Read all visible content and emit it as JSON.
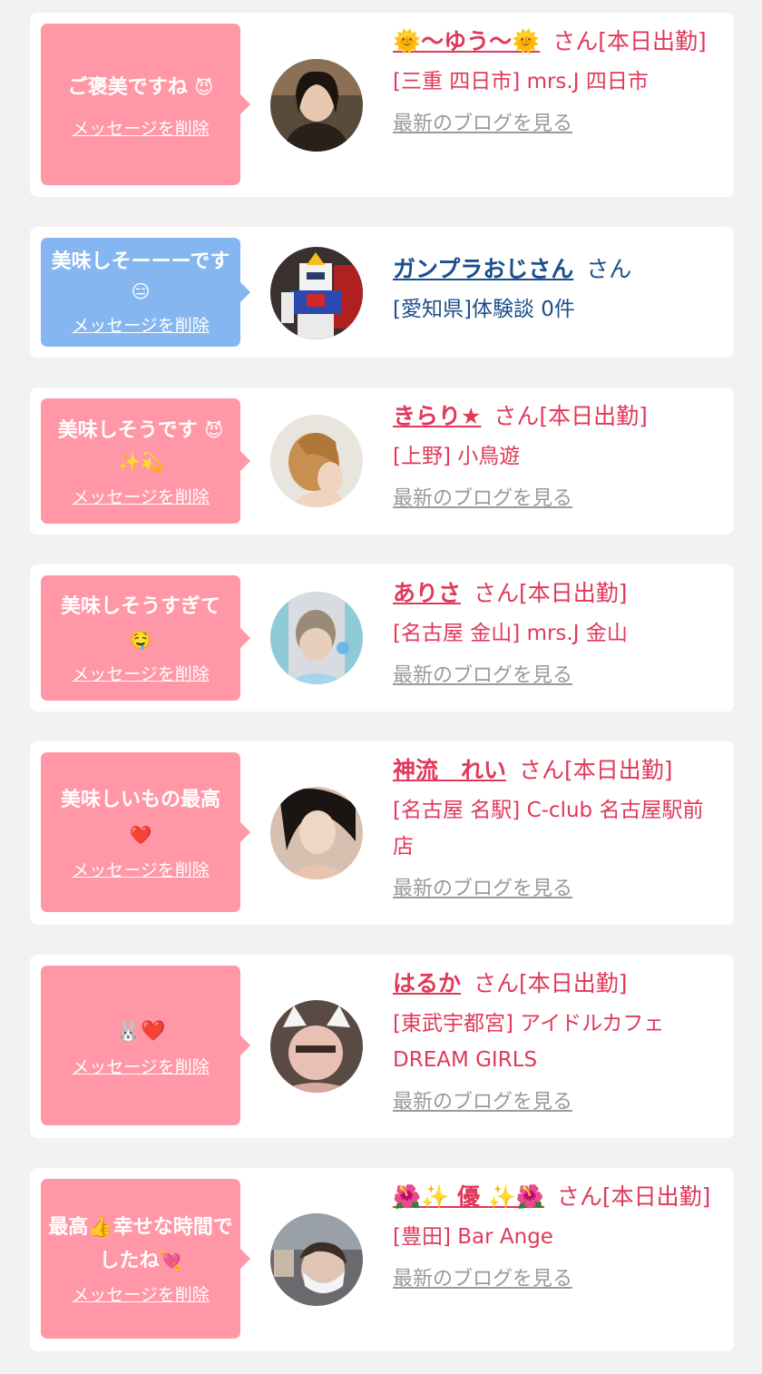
{
  "delete_label": "メッセージを削除",
  "blog_label": "最新のブログを見る",
  "cards": [
    {
      "message": "ご褒美ですね",
      "message_emoji": "😈",
      "name": "🌞〜ゆう〜🌞",
      "suffix": "さん[本日出勤]",
      "shop": "[三重 四日市] mrs.J 四日市",
      "blog": true,
      "bubble_color": "#ff97a6",
      "avatar_icon": "woman-portrait-photo"
    },
    {
      "message": "美味しそーーーです",
      "message_emoji": "😑",
      "name": "ガンプラおじさん",
      "suffix": "さん",
      "shop": "[愛知県]体験談 0件",
      "blog": false,
      "bubble_color": "#86b6ef",
      "avatar_icon": "gundam-model-photo"
    },
    {
      "message": "美味しそうです",
      "message_emoji": "😈✨💫",
      "name": "きらり★",
      "suffix": "さん[本日出勤]",
      "shop": "[上野] 小鳥遊",
      "blog": true,
      "bubble_color": "#ff97a6",
      "avatar_icon": "short-hair-photo"
    },
    {
      "message": "美味しそうすぎて",
      "message_emoji": "🤤",
      "name": "ありさ",
      "suffix": "さん[本日出勤]",
      "shop": "[名古屋 金山] mrs.J 金山",
      "blog": true,
      "bubble_color": "#ff97a6",
      "avatar_icon": "blurred-portrait-photo"
    },
    {
      "message": "美味しいもの最高",
      "message_emoji": "❤️",
      "name": "神流　れい",
      "suffix": "さん[本日出勤]",
      "shop": "[名古屋 名駅] C-club 名古屋駅前店",
      "blog": true,
      "bubble_color": "#ff97a6",
      "avatar_icon": "woman-portrait-photo"
    },
    {
      "message": "",
      "message_emoji": "🐰❤️",
      "name": "はるか",
      "suffix": "さん[本日出勤]",
      "shop": "[東武宇都宮] アイドルカフェ DREAM GIRLS",
      "blog": true,
      "bubble_color": "#ff97a6",
      "avatar_icon": "cat-ears-selfie-photo"
    },
    {
      "message": "最高👍幸せな時間でしたね",
      "message_emoji": "💘",
      "name": "🌺✨ 優 ✨🌺",
      "suffix": "さん[本日出勤]",
      "shop": "[豊田] Bar Ange",
      "blog": true,
      "bubble_color": "#ff97a6",
      "avatar_icon": "masked-selfie-photo"
    }
  ]
}
